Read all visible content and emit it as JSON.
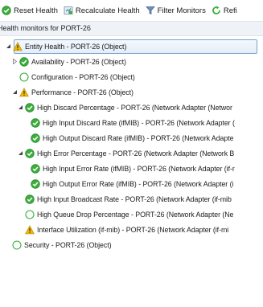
{
  "toolbar": {
    "buttons": [
      {
        "label": "Reset Health",
        "icon": "reset-health-icon"
      },
      {
        "label": "Recalculate Health",
        "icon": "recalculate-health-icon"
      },
      {
        "label": "Filter Monitors",
        "icon": "filter-icon"
      },
      {
        "label": "Refi",
        "icon": "refresh-icon"
      }
    ]
  },
  "header": {
    "title": "Health monitors for PORT-26"
  },
  "colors": {
    "healthy": "#3cae3c",
    "warning": "#f2b705",
    "selection": "#7da2ce"
  },
  "tree": [
    {
      "label": "Entity Health - PORT-26 (Object)",
      "state": "warning",
      "expander": "expanded"
    },
    {
      "label": "Availability - PORT-26 (Object)",
      "state": "healthy",
      "expander": "collapsed"
    },
    {
      "label": "Configuration - PORT-26 (Object)",
      "state": "empty",
      "expander": "none"
    },
    {
      "label": "Performance - PORT-26 (Object)",
      "state": "warning",
      "expander": "expanded"
    },
    {
      "label": "High Discard Percentage - PORT-26 (Network Adapter (Networ",
      "state": "healthy",
      "expander": "expanded"
    },
    {
      "label": "High Input Discard Rate (ifMIB) - PORT-26 (Network Adapter (",
      "state": "healthy",
      "expander": "none"
    },
    {
      "label": "High Output Discard Rate (ifMIB) - PORT-26 (Network Adapte",
      "state": "healthy",
      "expander": "none"
    },
    {
      "label": "High Error Percentage - PORT-26 (Network Adapter (Network B",
      "state": "healthy",
      "expander": "expanded"
    },
    {
      "label": "High Input Error Rate (ifMIB) - PORT-26 (Network Adapter (if-r",
      "state": "healthy",
      "expander": "none"
    },
    {
      "label": "High Output Error Rate (ifMIB) - PORT-26 (Network Adapter (i",
      "state": "healthy",
      "expander": "none"
    },
    {
      "label": "High Input Broadcast Rate - PORT-26 (Network Adapter (if-mib",
      "state": "healthy",
      "expander": "none"
    },
    {
      "label": "High Queue Drop Percentage - PORT-26 (Network Adapter (Ne",
      "state": "empty",
      "expander": "none"
    },
    {
      "label": "Interface Utilization (if-mib) - PORT-26 (Network Adapter (if-mi",
      "state": "warning",
      "expander": "none"
    },
    {
      "label": "Security - PORT-26 (Object)",
      "state": "empty",
      "expander": "none"
    }
  ]
}
